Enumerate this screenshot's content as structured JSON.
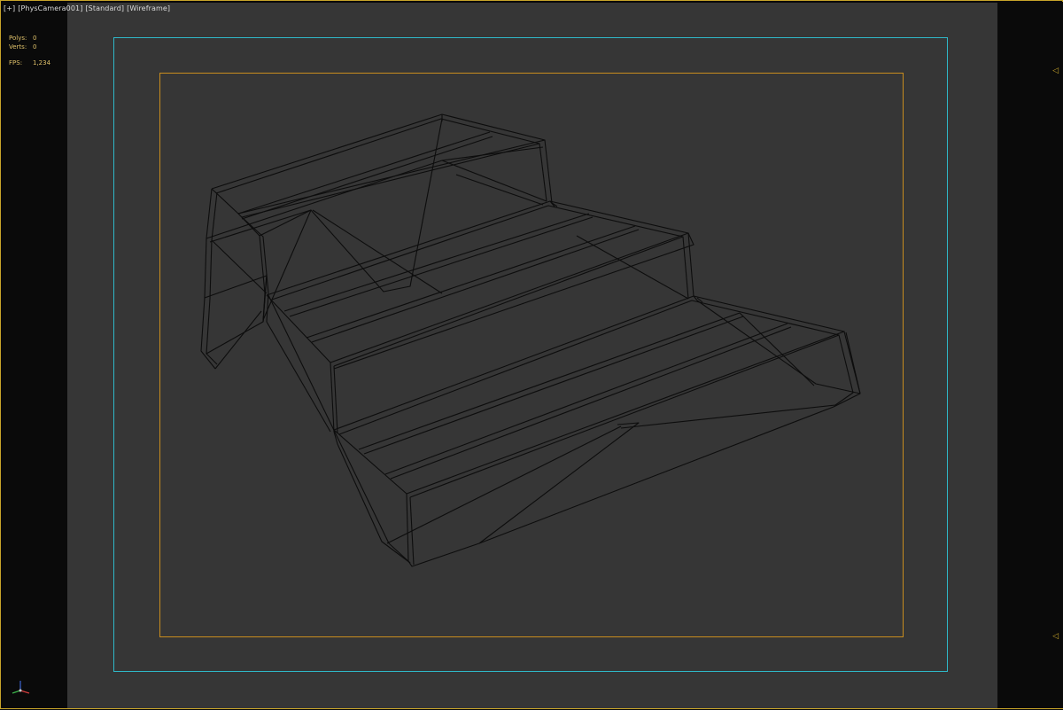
{
  "viewport": {
    "label_plus": "[+]",
    "label_camera": "[PhysCamera001]",
    "label_shading_mode": "[Standard]",
    "label_display_mode": "[Wireframe]"
  },
  "stats": {
    "polys_label": "Polys:",
    "polys_value": "0",
    "verts_label": "Verts:",
    "verts_value": "0",
    "fps_label": "FPS:",
    "fps_value": "1,234"
  },
  "colors": {
    "frame_border": "#c8a52a",
    "safe_frame_outer": "#2fb8c8",
    "safe_frame_inner": "#c88c1e",
    "scene_bg": "#363636",
    "wire": "#0d0d0d"
  },
  "icons": {
    "side_panel_top": "collapse-arrow-icon",
    "side_panel_bottom": "collapse-arrow-icon",
    "gizmo": "axis-gizmo-icon"
  }
}
